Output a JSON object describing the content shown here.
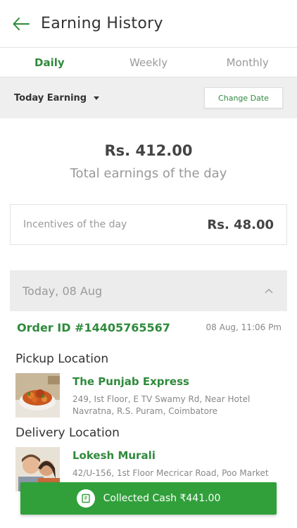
{
  "header": {
    "title": "Earning History",
    "back_icon": "arrow-left-icon"
  },
  "tabs": [
    {
      "label": "Daily",
      "active": true
    },
    {
      "label": "Weekly",
      "active": false
    },
    {
      "label": "Monthly",
      "active": false
    }
  ],
  "filter": {
    "label": "Today Earning",
    "change_date": "Change Date"
  },
  "summary": {
    "amount": "Rs. 412.00",
    "caption": "Total earnings of the day"
  },
  "incentive": {
    "label": "Incentives of the day",
    "value": "Rs. 48.00"
  },
  "day_group": {
    "label": "Today, 08 Aug"
  },
  "order": {
    "id": "Order ID #14405765567",
    "time": "08 Aug, 11:06 Pm",
    "pickup": {
      "title": "Pickup Location",
      "name": "The Punjab Express",
      "address_line1": "249, Ist Floor, E TV Swamy Rd, Near Hotel",
      "address_line2": "Navratna, R.S. Puram, Coimbatore"
    },
    "delivery": {
      "title": "Delivery Location",
      "name": "Lokesh Murali",
      "address_line1": "42/U-156, 1st Floor Mecricar Road, Poo Market"
    }
  },
  "cta": {
    "label": "Collected Cash ₹441.00",
    "icon": "cash-note-icon"
  },
  "colors": {
    "accent": "#2f8a3c",
    "cta": "#31a03b"
  }
}
